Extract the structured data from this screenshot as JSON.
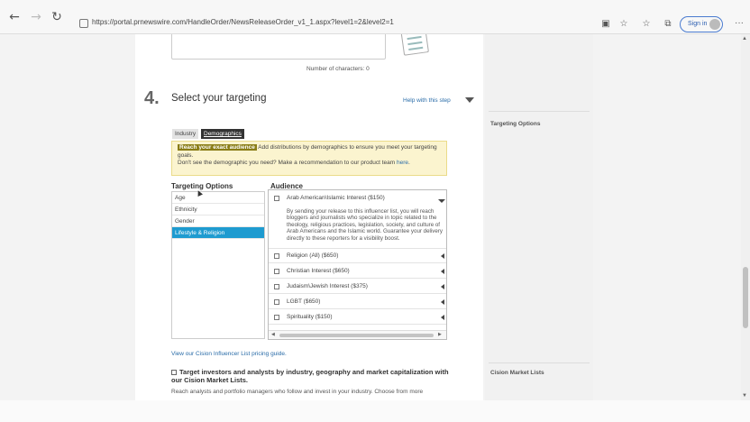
{
  "browser": {
    "url": "https://portal.prnewswire.com/HandleOrder/NewsReleaseOrder_v1_1.aspx?level1=2&level2=1",
    "signin_label": "Sign in"
  },
  "form": {
    "char_count_text": "Number of characters: 0"
  },
  "step": {
    "number": "4.",
    "title": "Select your targeting",
    "help_label": "Help with this step"
  },
  "tabs": [
    "Industry",
    "Demographics"
  ],
  "notice": {
    "badge": "Reach your exact audience",
    "text1": "Add distributions by demographics to ensure you meet your targeting goals.",
    "text2": "Don't see the demographic you need? Make a recommendation to our product team",
    "link": "here",
    "period": "."
  },
  "targeting": {
    "header": "Targeting Options",
    "options": [
      "Age",
      "Ethnicity",
      "Gender",
      "Lifestyle & Religion"
    ],
    "selected_index": 3
  },
  "audience": {
    "header": "Audience",
    "items": [
      {
        "label": "Arab American\\Islamic Interest ($150)",
        "expanded": true
      },
      {
        "label": "Religion (All) ($650)"
      },
      {
        "label": "Christian Interest ($650)"
      },
      {
        "label": "Judaism\\Jewish Interest ($375)"
      },
      {
        "label": "LGBT ($650)"
      },
      {
        "label": "Spirituality ($150)"
      }
    ],
    "expanded_description": "By sending your release to this influencer list, you will reach bloggers and journalists who specialize in topic related to the theology, religious practices, legislation, society, and culture of Arab Americans and the Islamic world. Guarantee your delivery directly to these reporters for a visibility boost."
  },
  "pricing_link": "View our Cision Influencer List pricing guide.",
  "investors": {
    "title": "Target investors and analysts by industry, geography and market capitalization with our Cision Market Lists.",
    "body": "Reach analysts and portfolio managers who follow and invest in your industry. Choose from more"
  },
  "right_column": {
    "label1": "Targeting Options",
    "label2": "Cision Market Lists"
  }
}
